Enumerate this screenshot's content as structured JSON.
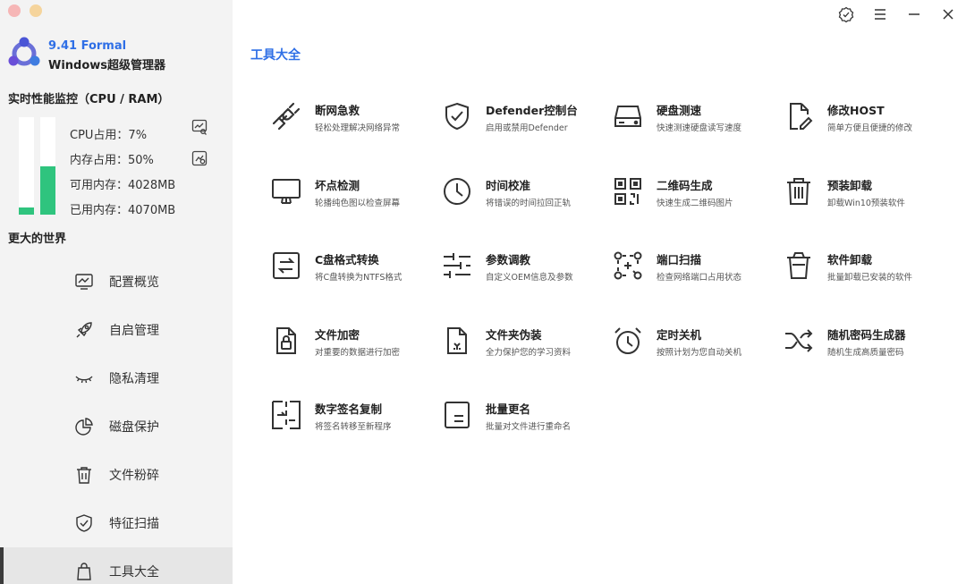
{
  "app": {
    "version": "9.41 Formal",
    "name": "Windows超级管理器"
  },
  "performance": {
    "title": "实时性能监控（CPU / RAM）",
    "cpu_percent": 7,
    "mem_percent": 50,
    "cpu_text": "CPU占用：7%",
    "mem_text": "内存占用：50%",
    "avail_text": "可用内存：4028MB",
    "used_text": "已用内存：4070MB",
    "accent": "#2fc47e"
  },
  "sidebar": {
    "world_title": "更大的世界",
    "items": [
      {
        "label": "配置概览",
        "icon": "monitor-chart-icon"
      },
      {
        "label": "自启管理",
        "icon": "rocket-icon"
      },
      {
        "label": "隐私清理",
        "icon": "closed-eye-icon"
      },
      {
        "label": "磁盘保护",
        "icon": "pie-chart-icon"
      },
      {
        "label": "文件粉碎",
        "icon": "trash-icon"
      },
      {
        "label": "特征扫描",
        "icon": "shield-check-icon"
      },
      {
        "label": "工具大全",
        "icon": "bag-icon",
        "active": true
      }
    ]
  },
  "main": {
    "title": "工具大全",
    "accent": "#2f6fe6",
    "tools": [
      {
        "title": "断网急救",
        "desc": "轻松处理解决网络异常",
        "icon": "plug-icon"
      },
      {
        "title": "Defender控制台",
        "desc": "启用或禁用Defender",
        "icon": "shield-check-icon"
      },
      {
        "title": "硬盘测速",
        "desc": "快速测速硬盘读写速度",
        "icon": "hard-drive-icon"
      },
      {
        "title": "修改HOST",
        "desc": "简单方便且便捷的修改",
        "icon": "file-edit-icon"
      },
      {
        "title": "坏点检测",
        "desc": "轮播纯色图以检查屏幕",
        "icon": "monitor-icon"
      },
      {
        "title": "时间校准",
        "desc": "将错误的时间拉回正轨",
        "icon": "clock-icon"
      },
      {
        "title": "二维码生成",
        "desc": "快速生成二维码图片",
        "icon": "qr-code-icon"
      },
      {
        "title": "预装卸载",
        "desc": "卸载Win10预装软件",
        "icon": "trash-icon"
      },
      {
        "title": "C盘格式转换",
        "desc": "将C盘转换为NTFS格式",
        "icon": "convert-icon"
      },
      {
        "title": "参数调教",
        "desc": "自定义OEM信息及参数",
        "icon": "sliders-icon"
      },
      {
        "title": "端口扫描",
        "desc": "检查网络端口占用状态",
        "icon": "scan-icon"
      },
      {
        "title": "软件卸载",
        "desc": "批量卸载已安装的软件",
        "icon": "trash-icon"
      },
      {
        "title": "文件加密",
        "desc": "对重要的数据进行加密",
        "icon": "file-lock-icon"
      },
      {
        "title": "文件夹伪装",
        "desc": "全力保护您的学习资料",
        "icon": "file-mask-icon"
      },
      {
        "title": "定时关机",
        "desc": "按照计划为您自动关机",
        "icon": "alarm-clock-icon"
      },
      {
        "title": "随机密码生成器",
        "desc": "随机生成高质量密码",
        "icon": "shuffle-icon"
      },
      {
        "title": "数字签名复制",
        "desc": "将签名转移至新程序",
        "icon": "signature-copy-icon"
      },
      {
        "title": "批量更名",
        "desc": "批量对文件进行重命名",
        "icon": "rename-icon"
      }
    ]
  },
  "window_controls": [
    "verified-badge-icon",
    "menu-icon",
    "minimize-icon",
    "close-icon"
  ]
}
